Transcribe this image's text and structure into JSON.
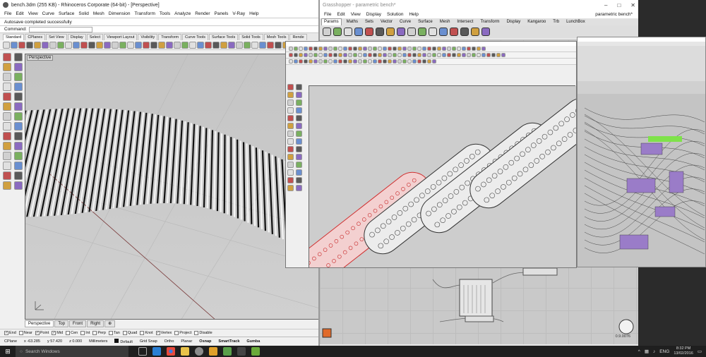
{
  "rhino": {
    "title": "bench.3dm (255 KB) - Rhinoceros Corporate (64-bit) - [Perspective]",
    "menus": [
      "File",
      "Edit",
      "View",
      "Curve",
      "Surface",
      "Solid",
      "Mesh",
      "Dimension",
      "Transform",
      "Tools",
      "Analyze",
      "Render",
      "Panels",
      "V-Ray",
      "Help"
    ],
    "command_history": "Autosave completed successfully",
    "command_label": "Command:",
    "toolbar_tabs": [
      "Standard",
      "CPlanes",
      "Set View",
      "Display",
      "Select",
      "Viewport Layout",
      "Visibility",
      "Transform",
      "Curve Tools",
      "Surface Tools",
      "Solid Tools",
      "Mesh Tools",
      "Rende"
    ],
    "viewport_label": "Perspective",
    "viewport_tabs": [
      "Perspective",
      "Top",
      "Front",
      "Right",
      "⊕"
    ],
    "osnaps": [
      {
        "label": "End",
        "checked": true
      },
      {
        "label": "Near",
        "checked": false
      },
      {
        "label": "Point",
        "checked": true
      },
      {
        "label": "Mid",
        "checked": true
      },
      {
        "label": "Cen",
        "checked": false
      },
      {
        "label": "Int",
        "checked": false
      },
      {
        "label": "Perp",
        "checked": false
      },
      {
        "label": "Tan",
        "checked": false
      },
      {
        "label": "Quad",
        "checked": false
      },
      {
        "label": "Knot",
        "checked": false
      },
      {
        "label": "Vertex",
        "checked": true
      },
      {
        "label": "Project",
        "checked": false
      },
      {
        "label": "Disable",
        "checked": false
      }
    ],
    "status": {
      "cplane": "CPlane",
      "x": "x -63.285",
      "y": "y 57.420",
      "z": "z 0.000",
      "units": "Millimeters",
      "layer": "Default",
      "grid_snap": "Grid Snap",
      "ortho": "Ortho",
      "planar": "Planar",
      "osnap": "Osnap",
      "smarttrack": "SmartTrack",
      "gumball": "Gumba"
    }
  },
  "grasshopper": {
    "title": "Grasshopper - parametric bench*",
    "doc_name": "parametric bench*",
    "menus": [
      "File",
      "Edit",
      "View",
      "Display",
      "Solution",
      "Help"
    ],
    "tabs": [
      "Params",
      "Maths",
      "Sets",
      "Vector",
      "Curve",
      "Surface",
      "Mesh",
      "Intersect",
      "Transform",
      "Display",
      "Kangaroo",
      "Trb",
      "LunchBox"
    ],
    "zoom_text": "0.9.0076"
  },
  "taskbar": {
    "search_placeholder": "Search Windows",
    "language": "ENG",
    "time": "8:32 PM",
    "date": "13/02/2016"
  },
  "colors": {
    "rhino_bg": "#c9c9c9",
    "selection_red": "#e04040",
    "gh_purple": "#9a7cc8",
    "gh_green": "#7fe24a"
  }
}
